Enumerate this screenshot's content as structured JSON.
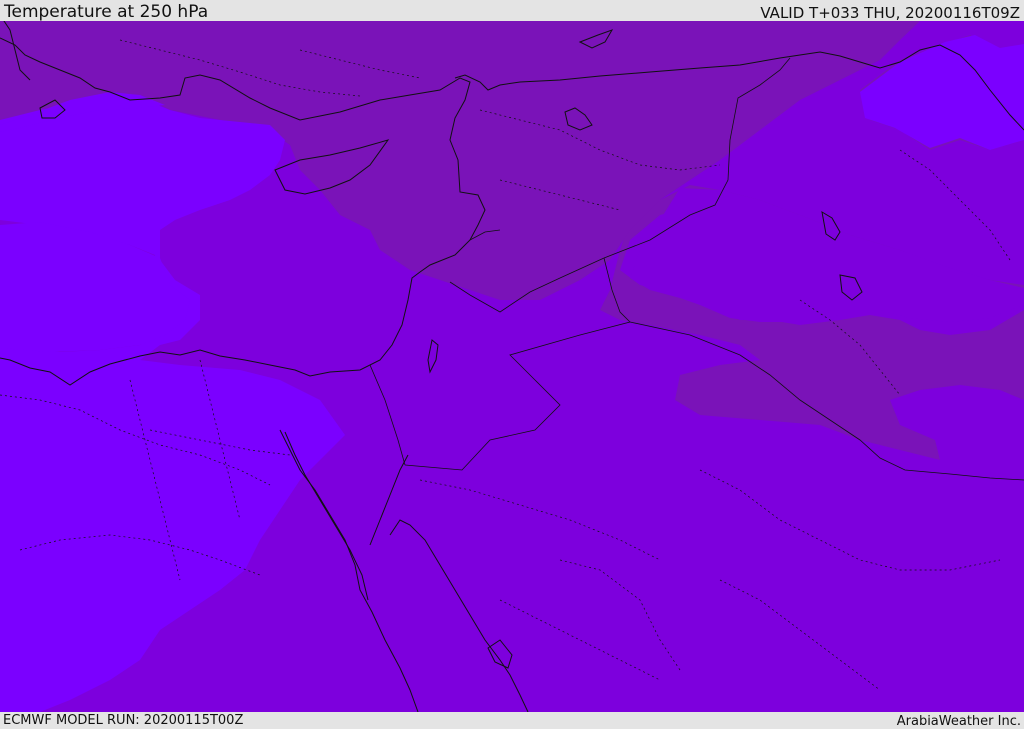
{
  "header": {
    "title": "Temperature at 250 hPa",
    "valid": "VALID T+033 THU, 20200116T09Z"
  },
  "footer": {
    "model_run": "ECMWF MODEL RUN: 20200115T00Z",
    "credit": "ArabiaWeather Inc."
  },
  "map": {
    "region": "Eastern Mediterranean and Middle East",
    "field": "temperature",
    "level": "250 hPa",
    "colors": {
      "warmest_band": "#7b00ff",
      "mid_band": "#7d00dd",
      "cool_band": "#7a13b8",
      "coastline": "#111111",
      "borders": "#111111",
      "frame_background": "#e4e4e4"
    }
  }
}
